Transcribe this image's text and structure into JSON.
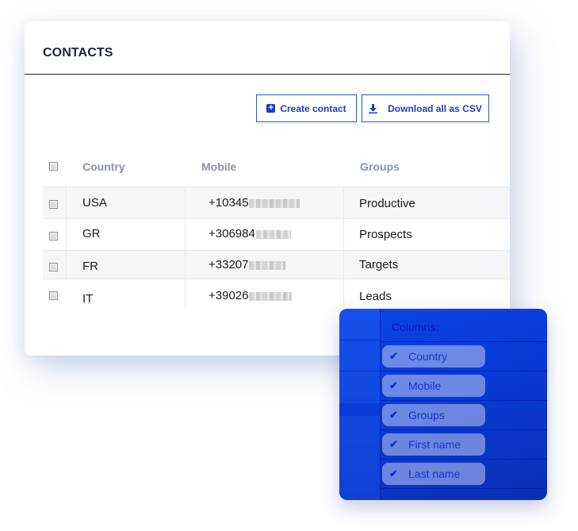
{
  "card": {
    "title": "CONTACTS",
    "actions": {
      "create_label": "Create contact",
      "create_icon": "plus-square-icon",
      "download_label": "Download all as CSV",
      "download_icon": "download-icon"
    }
  },
  "table": {
    "columns": [
      "Country",
      "Mobile",
      "Groups"
    ],
    "rows": [
      {
        "country": "USA",
        "mobile": "+10345",
        "group": "Productive"
      },
      {
        "country": "GR",
        "mobile": "+306984",
        "group": "Prospects"
      },
      {
        "country": "FR",
        "mobile": "+33207",
        "group": "Targets"
      },
      {
        "country": "IT",
        "mobile": "+39026",
        "group": "Leads"
      }
    ]
  },
  "columns_panel": {
    "title": "Columns:",
    "items": [
      {
        "label": "Country",
        "checked": true
      },
      {
        "label": "Mobile",
        "checked": true
      },
      {
        "label": "Groups",
        "checked": true
      },
      {
        "label": "First name",
        "checked": true
      },
      {
        "label": "Last name",
        "checked": true
      }
    ],
    "check_glyph": "✔"
  },
  "colors": {
    "accent": "#1d3fc4",
    "panel": "#0a3ad6"
  }
}
